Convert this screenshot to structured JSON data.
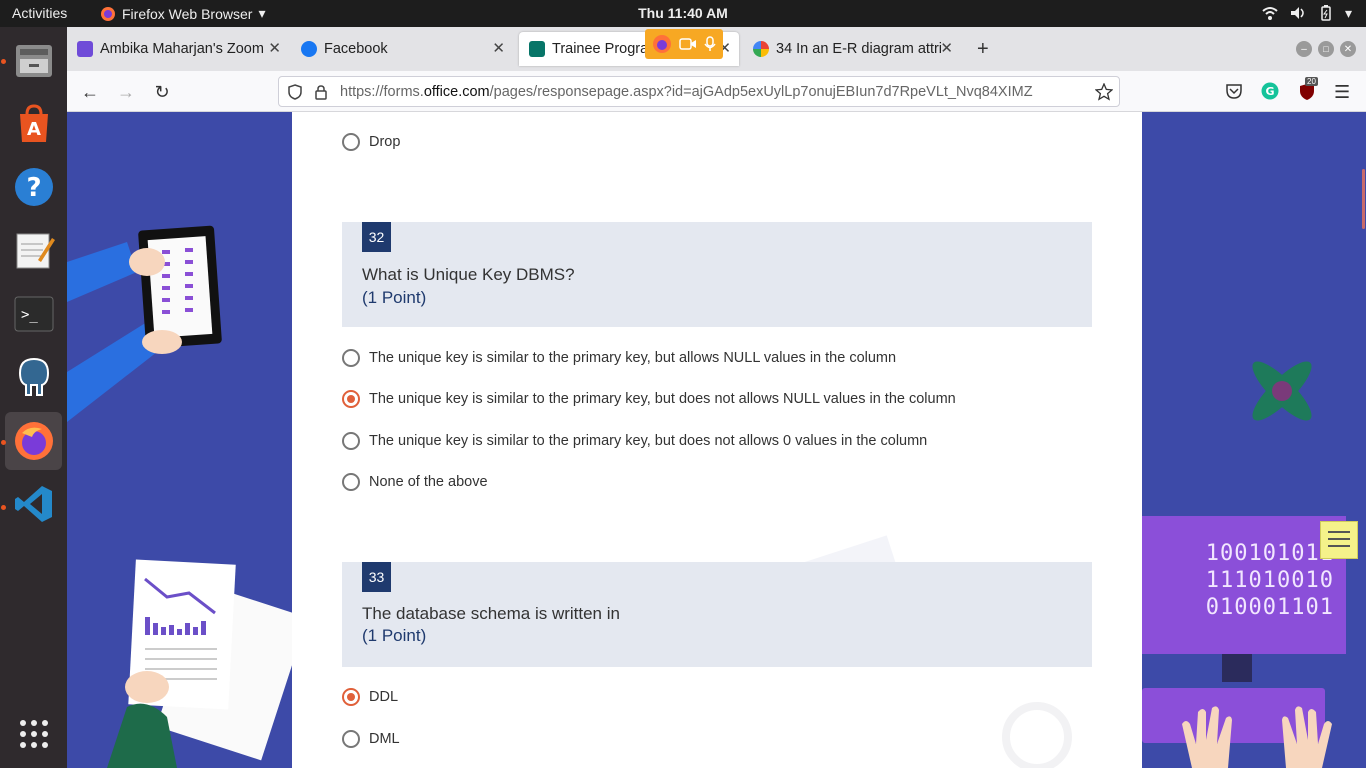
{
  "topbar": {
    "activities": "Activities",
    "app_name": "Firefox Web Browser",
    "clock": "Thu 11:40 AM",
    "tray_icons": [
      "wifi-icon",
      "volume-icon",
      "battery-icon",
      "power-menu-icon"
    ]
  },
  "dock": {
    "items": [
      "files",
      "ubuntu-software",
      "help",
      "text-editor",
      "terminal",
      "pgadmin",
      "firefox",
      "vscode"
    ],
    "show_apps": "show-applications"
  },
  "tabs": [
    {
      "title": "Ambika Maharjan's Zoom",
      "favicon": "zoom"
    },
    {
      "title": "Facebook",
      "favicon": "facebook"
    },
    {
      "title": "Trainee Progra",
      "favicon": "forms"
    },
    {
      "title": "34 In an E-R diagram attri",
      "favicon": "google"
    }
  ],
  "sharing_indicator": [
    "firefox-icon",
    "camera-icon",
    "microphone-icon"
  ],
  "url": {
    "prefix": "https://forms.",
    "domain": "office.com",
    "path": "/pages/responsepage.aspx?id=ajGAdp5exUylLp7onujEBIun7d7RpeVLt_Nvq84XIMZ"
  },
  "extensions": {
    "badge": "20"
  },
  "form": {
    "prev_option": {
      "label": "Drop",
      "checked": false
    },
    "questions": [
      {
        "number": "32",
        "text": "What is Unique Key DBMS?",
        "points": "(1 Point)",
        "options": [
          {
            "label": "The unique key is similar to the primary key, but allows NULL values in the column",
            "checked": false
          },
          {
            "label": "The unique key is similar to the primary key, but does not allows NULL values in the column",
            "checked": true
          },
          {
            "label": "The unique key is similar to the primary key, but does not allows 0 values in the column",
            "checked": false
          },
          {
            "label": "None of the above",
            "checked": false
          }
        ]
      },
      {
        "number": "33",
        "text": "The database schema is written in",
        "points": "(1 Point)",
        "options": [
          {
            "label": "DDL",
            "checked": true
          },
          {
            "label": "DML",
            "checked": false
          }
        ]
      }
    ]
  },
  "decor": {
    "binary_lines": [
      "100101011",
      "111010010",
      "010001101"
    ],
    "accent": "#3d4aa8",
    "selected_color": "#e0603a",
    "header_color": "#1f3a6e"
  }
}
